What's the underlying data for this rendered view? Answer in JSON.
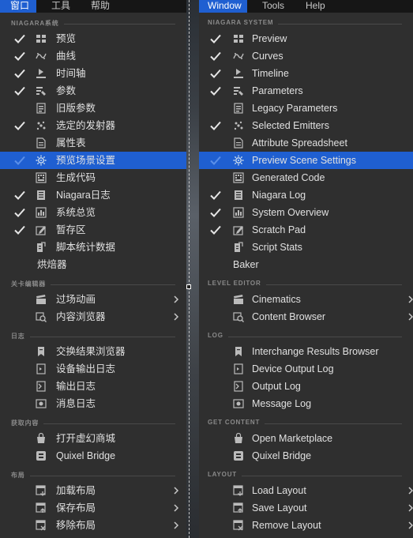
{
  "colors": {
    "accent": "#1f5fd1",
    "menu_bg": "#2f2f2f",
    "menubar_bg": "#161616",
    "section_text": "#8a8a8a"
  },
  "left": {
    "menubar": [
      {
        "label": "窗口",
        "active": true
      },
      {
        "label": "工具",
        "active": false
      },
      {
        "label": "帮助",
        "active": false
      }
    ],
    "menu": [
      {
        "type": "section",
        "label": "NIAGARA系统"
      },
      {
        "type": "item",
        "label": "预览",
        "checked": true,
        "icon": "preview-icon"
      },
      {
        "type": "item",
        "label": "曲线",
        "checked": true,
        "icon": "curves-icon"
      },
      {
        "type": "item",
        "label": "时间轴",
        "checked": true,
        "icon": "timeline-icon"
      },
      {
        "type": "item",
        "label": "参数",
        "checked": true,
        "icon": "parameters-icon"
      },
      {
        "type": "item",
        "label": "旧版参数",
        "checked": false,
        "icon": "legacy-parameters-icon"
      },
      {
        "type": "item",
        "label": "选定的发射器",
        "checked": true,
        "icon": "emitters-icon"
      },
      {
        "type": "item",
        "label": "属性表",
        "checked": false,
        "icon": "spreadsheet-icon"
      },
      {
        "type": "item",
        "label": "预览场景设置",
        "checked": true,
        "icon": "gear-icon",
        "selected": true
      },
      {
        "type": "item",
        "label": "生成代码",
        "checked": false,
        "icon": "generated-code-icon"
      },
      {
        "type": "item",
        "label": "Niagara日志",
        "checked": true,
        "icon": "log-icon"
      },
      {
        "type": "item",
        "label": "系统总览",
        "checked": true,
        "icon": "system-overview-icon"
      },
      {
        "type": "item",
        "label": "暂存区",
        "checked": true,
        "icon": "scratch-pad-icon"
      },
      {
        "type": "item",
        "label": "脚本统计数据",
        "checked": false,
        "icon": "script-stats-icon"
      },
      {
        "type": "item",
        "label": "烘焙器",
        "checked": false,
        "icon": ""
      },
      {
        "type": "section",
        "label": "关卡编辑器"
      },
      {
        "type": "item",
        "label": "过场动画",
        "checked": false,
        "icon": "cinematics-icon",
        "submenu": true
      },
      {
        "type": "item",
        "label": "内容浏览器",
        "checked": false,
        "icon": "content-browser-icon",
        "submenu": true
      },
      {
        "type": "section",
        "label": "日志"
      },
      {
        "type": "item",
        "label": "交换结果浏览器",
        "checked": false,
        "icon": "interchange-icon"
      },
      {
        "type": "item",
        "label": "设备输出日志",
        "checked": false,
        "icon": "device-log-icon"
      },
      {
        "type": "item",
        "label": "输出日志",
        "checked": false,
        "icon": "output-log-icon"
      },
      {
        "type": "item",
        "label": "消息日志",
        "checked": false,
        "icon": "message-log-icon"
      },
      {
        "type": "section",
        "label": "获取内容"
      },
      {
        "type": "item",
        "label": "打开虚幻商城",
        "checked": false,
        "icon": "marketplace-icon"
      },
      {
        "type": "item",
        "label": "Quixel Bridge",
        "checked": false,
        "icon": "bridge-icon"
      },
      {
        "type": "section",
        "label": "布局"
      },
      {
        "type": "item",
        "label": "加载布局",
        "checked": false,
        "icon": "load-layout-icon",
        "submenu": true
      },
      {
        "type": "item",
        "label": "保存布局",
        "checked": false,
        "icon": "save-layout-icon",
        "submenu": true
      },
      {
        "type": "item",
        "label": "移除布局",
        "checked": false,
        "icon": "remove-layout-icon",
        "submenu": true
      }
    ]
  },
  "right": {
    "menubar": [
      {
        "label": "Window",
        "active": true
      },
      {
        "label": "Tools",
        "active": false
      },
      {
        "label": "Help",
        "active": false
      }
    ],
    "menu": [
      {
        "type": "section",
        "label": "NIAGARA SYSTEM"
      },
      {
        "type": "item",
        "label": "Preview",
        "checked": true,
        "icon": "preview-icon"
      },
      {
        "type": "item",
        "label": "Curves",
        "checked": true,
        "icon": "curves-icon"
      },
      {
        "type": "item",
        "label": "Timeline",
        "checked": true,
        "icon": "timeline-icon"
      },
      {
        "type": "item",
        "label": "Parameters",
        "checked": true,
        "icon": "parameters-icon"
      },
      {
        "type": "item",
        "label": "Legacy Parameters",
        "checked": false,
        "icon": "legacy-parameters-icon"
      },
      {
        "type": "item",
        "label": "Selected Emitters",
        "checked": true,
        "icon": "emitters-icon"
      },
      {
        "type": "item",
        "label": "Attribute Spreadsheet",
        "checked": false,
        "icon": "spreadsheet-icon"
      },
      {
        "type": "item",
        "label": "Preview Scene Settings",
        "checked": true,
        "icon": "gear-icon",
        "selected": true
      },
      {
        "type": "item",
        "label": "Generated Code",
        "checked": false,
        "icon": "generated-code-icon"
      },
      {
        "type": "item",
        "label": "Niagara Log",
        "checked": true,
        "icon": "log-icon"
      },
      {
        "type": "item",
        "label": "System Overview",
        "checked": true,
        "icon": "system-overview-icon"
      },
      {
        "type": "item",
        "label": "Scratch Pad",
        "checked": true,
        "icon": "scratch-pad-icon"
      },
      {
        "type": "item",
        "label": "Script Stats",
        "checked": false,
        "icon": "script-stats-icon"
      },
      {
        "type": "item",
        "label": "Baker",
        "checked": false,
        "icon": ""
      },
      {
        "type": "section",
        "label": "LEVEL EDITOR"
      },
      {
        "type": "item",
        "label": "Cinematics",
        "checked": false,
        "icon": "cinematics-icon",
        "submenu": true
      },
      {
        "type": "item",
        "label": "Content Browser",
        "checked": false,
        "icon": "content-browser-icon",
        "submenu": true
      },
      {
        "type": "section",
        "label": "LOG"
      },
      {
        "type": "item",
        "label": "Interchange Results Browser",
        "checked": false,
        "icon": "interchange-icon"
      },
      {
        "type": "item",
        "label": "Device Output Log",
        "checked": false,
        "icon": "device-log-icon"
      },
      {
        "type": "item",
        "label": "Output Log",
        "checked": false,
        "icon": "output-log-icon"
      },
      {
        "type": "item",
        "label": "Message Log",
        "checked": false,
        "icon": "message-log-icon"
      },
      {
        "type": "section",
        "label": "GET CONTENT"
      },
      {
        "type": "item",
        "label": "Open Marketplace",
        "checked": false,
        "icon": "marketplace-icon"
      },
      {
        "type": "item",
        "label": "Quixel Bridge",
        "checked": false,
        "icon": "bridge-icon"
      },
      {
        "type": "section",
        "label": "LAYOUT"
      },
      {
        "type": "item",
        "label": "Load Layout",
        "checked": false,
        "icon": "load-layout-icon",
        "submenu": true
      },
      {
        "type": "item",
        "label": "Save Layout",
        "checked": false,
        "icon": "save-layout-icon",
        "submenu": true
      },
      {
        "type": "item",
        "label": "Remove Layout",
        "checked": false,
        "icon": "remove-layout-icon",
        "submenu": true
      }
    ]
  }
}
